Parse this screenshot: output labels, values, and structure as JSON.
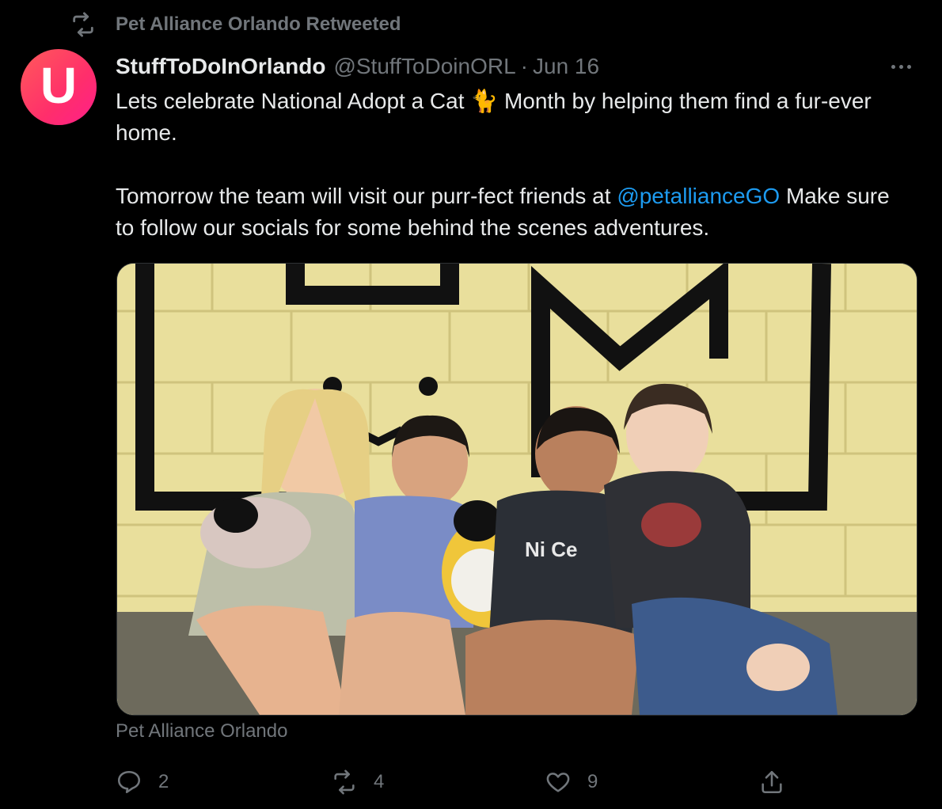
{
  "retweet": {
    "label": "Pet Alliance Orlando Retweeted"
  },
  "author": {
    "avatar_letter": "U",
    "display_name": "StuffToDoInOrlando",
    "handle": "@StuffToDoinORL",
    "separator": "·",
    "date": "Jun 16"
  },
  "tweet": {
    "line1_before_emoji": "Lets celebrate National Adopt a Cat ",
    "emoji": "🐈",
    "line1_after_emoji": " Month by helping them find a fur-ever home.",
    "line2_before_mention": "Tomorrow the team will visit our purr-fect friends at ",
    "mention": "@petallianceGO",
    "line2_after_mention": " Make sure to follow our socials for some behind the scenes adventures."
  },
  "media": {
    "source_label": "Pet Alliance Orlando"
  },
  "actions": {
    "reply_count": "2",
    "retweet_count": "4",
    "like_count": "9"
  },
  "icons": {
    "retweet": "retweet-icon",
    "more": "more-icon",
    "reply": "reply-icon",
    "like": "heart-icon",
    "share": "share-icon"
  },
  "colors": {
    "background": "#000000",
    "text": "#e7e9ea",
    "secondary": "#71767b",
    "link": "#1d9bf0",
    "avatar_gradient_start": "#ff5a5a",
    "avatar_gradient_end": "#ff1f8a"
  }
}
